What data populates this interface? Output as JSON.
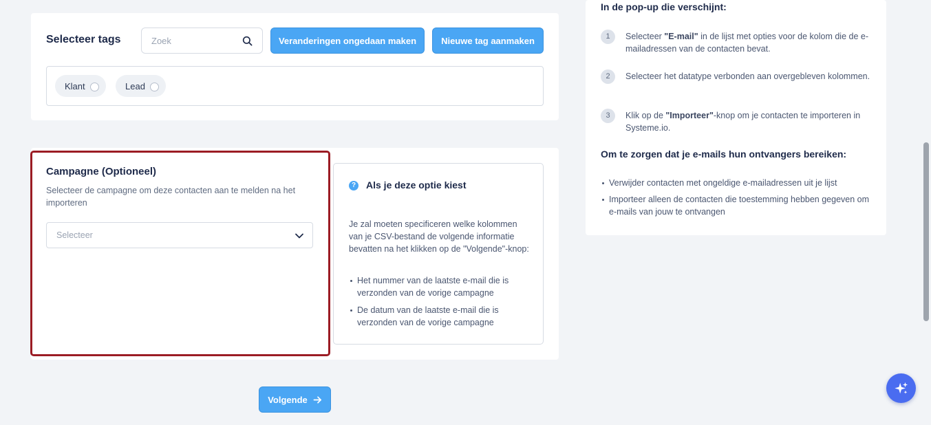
{
  "tags": {
    "title": "Selecteer tags",
    "search_placeholder": "Zoek",
    "undo_button": "Veranderingen ongedaan maken",
    "new_tag_button": "Nieuwe tag aanmaken",
    "items": [
      {
        "label": "Klant"
      },
      {
        "label": "Lead"
      }
    ]
  },
  "campaign": {
    "title": "Campagne (Optioneel)",
    "description": "Selecteer de campagne om deze contacten aan te melden na het importeren",
    "select_placeholder": "Selecteer"
  },
  "info": {
    "title": "Als je deze optie kiest",
    "body": "Je zal moeten specificeren welke kolommen van je CSV-bestand de volgende informatie bevatten na het klikken op de \"Volgende\"-knop:",
    "bullets": [
      "Het nummer van de laatste e-mail die is verzonden van de vorige campagne",
      "De datum van de laatste e-mail die is verzonden van de vorige campagne"
    ]
  },
  "next_button": "Volgende",
  "instructions": {
    "heading": "In de pop-up die verschijnt:",
    "steps": [
      {
        "num": "1",
        "pre": "Selecteer ",
        "bold": "\"E-mail\"",
        "post": " in de lijst met opties voor de kolom die de e-mailadressen van de contacten bevat."
      },
      {
        "num": "2",
        "pre": "Selecteer het datatype verbonden aan overgebleven kolommen.",
        "bold": "",
        "post": ""
      },
      {
        "num": "3",
        "pre": "Klik op de ",
        "bold": "\"Importeer\"",
        "post": "-knop om je contacten te importeren in Systeme.io."
      }
    ],
    "heading2": "Om te zorgen dat je e-mails hun ontvangers bereiken:",
    "bullets": [
      "Verwijder contacten met ongeldige e-mailadressen uit je lijst",
      "Importeer alleen de contacten die toestemming hebben gegeven om e-mails van jouw te ontvangen"
    ]
  },
  "colors": {
    "accent": "#4aa6f4",
    "highlight_border": "#9b1c24",
    "fab": "#4a6cf0"
  }
}
